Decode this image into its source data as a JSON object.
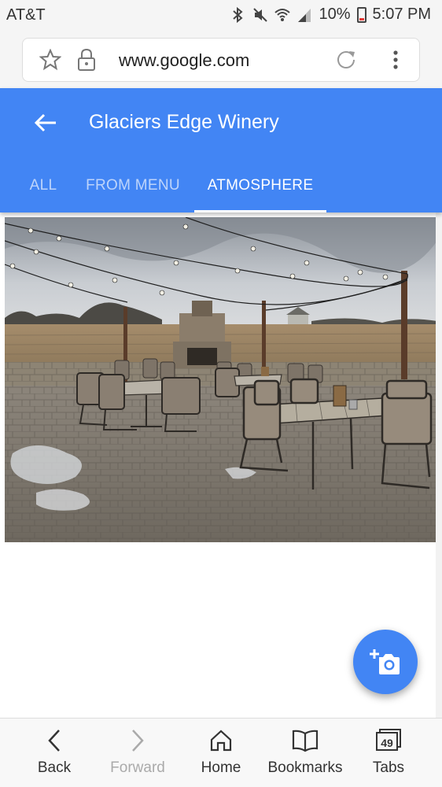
{
  "status_bar": {
    "carrier": "AT&T",
    "battery": "10%",
    "time": "5:07 PM"
  },
  "browser": {
    "url": "www.google.com"
  },
  "header": {
    "title": "Glaciers Edge Winery",
    "tabs": [
      {
        "label": "ALL",
        "active": false
      },
      {
        "label": "FROM MENU",
        "active": false
      },
      {
        "label": "ATMOSPHERE",
        "active": true
      }
    ]
  },
  "colors": {
    "primary": "#4285f4",
    "tab_inactive": "rgba(255,255,255,0.65)",
    "background": "#ffffff"
  },
  "photo": {
    "icon": "winery-patio-photo"
  },
  "fab": {
    "icon": "add-photo-icon"
  },
  "bottom_nav": {
    "back": "Back",
    "forward": "Forward",
    "home": "Home",
    "bookmarks": "Bookmarks",
    "tabs": "Tabs",
    "tabs_count": "49"
  }
}
